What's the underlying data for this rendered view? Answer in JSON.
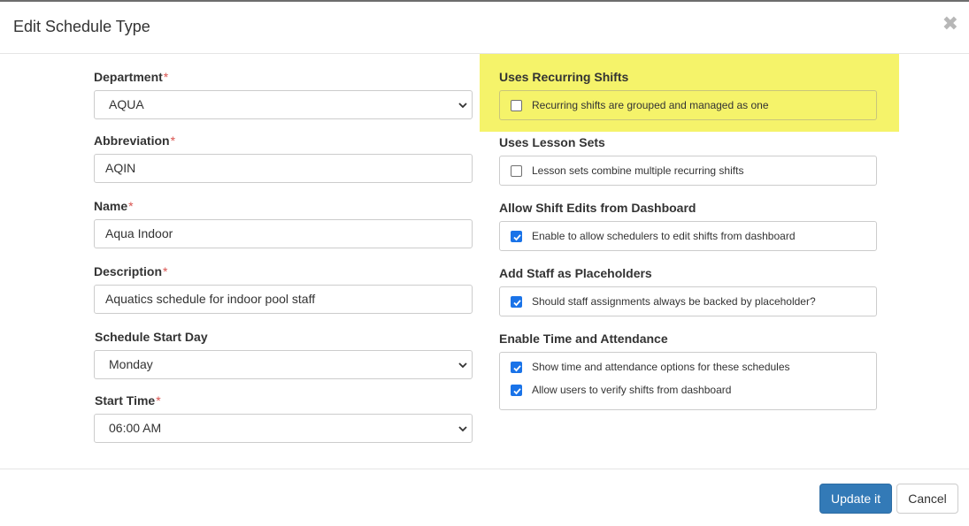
{
  "modal": {
    "title": "Edit Schedule Type",
    "close_glyph": "✖"
  },
  "required_marker": "*",
  "fields": {
    "department": {
      "label": "Department",
      "value": "AQUA"
    },
    "abbreviation": {
      "label": "Abbreviation",
      "value": "AQIN"
    },
    "name": {
      "label": "Name",
      "value": "Aqua Indoor"
    },
    "description": {
      "label": "Description",
      "value": "Aquatics schedule for indoor pool staff"
    },
    "start_day": {
      "label": "Schedule Start Day",
      "value": "Monday"
    },
    "start_time": {
      "label": "Start Time",
      "value": "06:00 AM"
    }
  },
  "options": {
    "recurring": {
      "heading": "Uses Recurring Shifts",
      "highlight_color": "#f5f36a",
      "items": [
        {
          "label": "Recurring shifts are grouped and managed as one",
          "checked": false
        }
      ]
    },
    "lesson_sets": {
      "heading": "Uses Lesson Sets",
      "items": [
        {
          "label": "Lesson sets combine multiple recurring shifts",
          "checked": false
        }
      ]
    },
    "shift_edits": {
      "heading": "Allow Shift Edits from Dashboard",
      "items": [
        {
          "label": "Enable to allow schedulers to edit shifts from dashboard",
          "checked": true
        }
      ]
    },
    "placeholders": {
      "heading": "Add Staff as Placeholders",
      "items": [
        {
          "label": "Should staff assignments always be backed by placeholder?",
          "checked": true
        }
      ]
    },
    "time_attendance": {
      "heading": "Enable Time and Attendance",
      "items": [
        {
          "label": "Show time and attendance options for these schedules",
          "checked": true
        },
        {
          "label": "Allow users to verify shifts from dashboard",
          "checked": true
        }
      ]
    }
  },
  "footer": {
    "update_label": "Update it",
    "cancel_label": "Cancel"
  },
  "colors": {
    "primary": "#337ab7",
    "required": "#d9534f",
    "checkbox_checked": "#1a73e8"
  }
}
